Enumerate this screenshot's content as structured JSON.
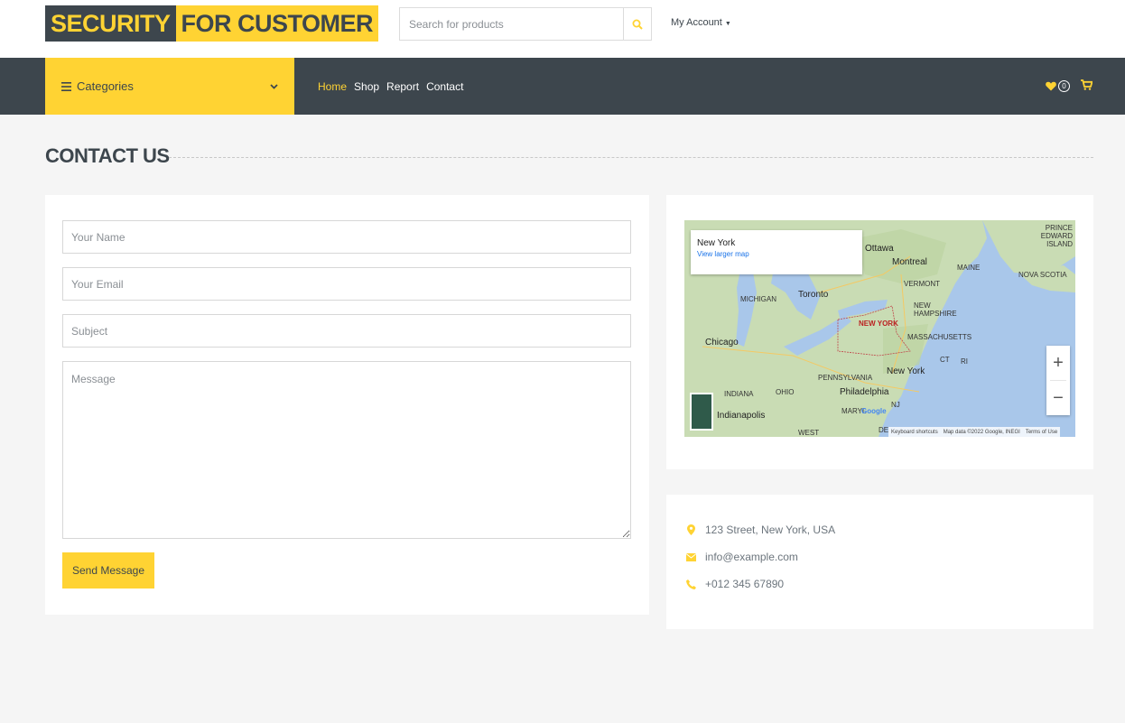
{
  "logo": {
    "part1": "SECURITY",
    "part2": "FOR CUSTOMER"
  },
  "search": {
    "placeholder": "Search for products"
  },
  "account": {
    "label": "My Account"
  },
  "nav": {
    "categories_label": "Categories",
    "links": [
      "Home",
      "Shop",
      "Report",
      "Contact"
    ],
    "active": "Home",
    "wishlist_count": "0"
  },
  "page": {
    "title": "CONTACT US"
  },
  "form": {
    "name_placeholder": "Your Name",
    "email_placeholder": "Your Email",
    "subject_placeholder": "Subject",
    "message_placeholder": "Message",
    "send_label": "Send Message"
  },
  "map": {
    "popup_title": "New York",
    "popup_link": "View larger map",
    "labels": {
      "ottawa": "Ottawa",
      "montreal": "Montreal",
      "maine": "MAINE",
      "nova_scotia": "NOVA SCOTIA",
      "pei": "PRINCE EDWARD ISLAND",
      "vermont": "VERMONT",
      "new_hampshire": "NEW HAMPSHIRE",
      "massachusetts": "MASSACHUSETTS",
      "michigan": "MICHIGAN",
      "toronto": "Toronto",
      "new_york_state": "NEW YORK",
      "chicago": "Chicago",
      "ct": "CT",
      "ri": "RI",
      "pennsylvania": "PENNSYLVANIA",
      "new_york_city": "New York",
      "philadelphia": "Philadelphia",
      "indiana": "INDIANA",
      "ohio": "OHIO",
      "nj": "NJ",
      "indianapolis": "Indianapolis",
      "maryland": "MARYL",
      "de": "DE",
      "west": "WEST",
      "google": "Google"
    },
    "attribution": [
      "Keyboard shortcuts",
      "Map data ©2022 Google, INEGI",
      "Terms of Use"
    ]
  },
  "contact": {
    "address": "123 Street, New York, USA",
    "email": "info@example.com",
    "phone": "+012 345 67890"
  },
  "colors": {
    "accent": "#ffd333",
    "dark": "#3d464d",
    "background": "#f5f5f5"
  },
  "icons": [
    "search-icon",
    "caret-down-icon",
    "bars-icon",
    "chevron-down-icon",
    "heart-icon",
    "cart-icon",
    "map-marker-icon",
    "envelope-icon",
    "phone-icon"
  ]
}
